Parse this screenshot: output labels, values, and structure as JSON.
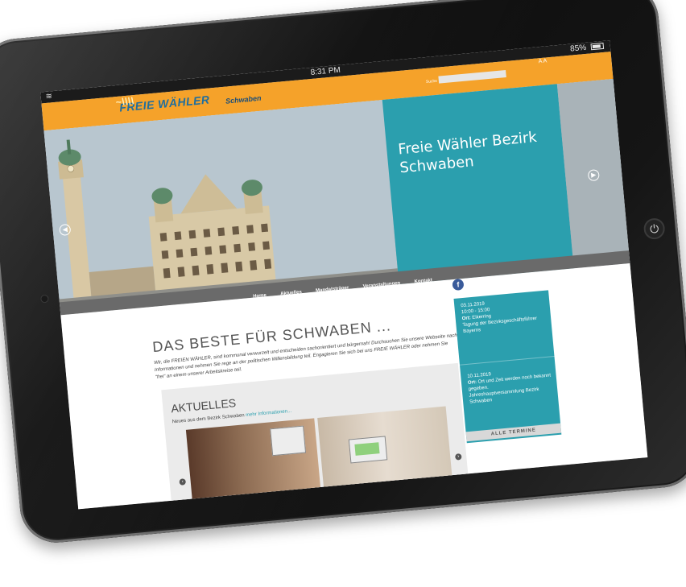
{
  "statusbar": {
    "time": "8:31 PM",
    "battery": "85%",
    "wifi_icon": "wifi-icon"
  },
  "header": {
    "logo_text": "FREIE WÄHLER",
    "region": "Schwaben",
    "font_size_control": "A A",
    "search_label": "Suche",
    "search_value": ""
  },
  "hero": {
    "title": "Freie Wähler Bezirk Schwaben"
  },
  "nav": {
    "items": [
      "Home",
      "Aktuelles",
      "Mandatsträger",
      "Veranstaltungen",
      "Kontakt"
    ]
  },
  "main": {
    "title": "DAS BESTE FÜR SCHWABEN ...",
    "intro": "Wir, die FREIEN WÄHLER, sind kommunal verwurzelt und entscheiden sachorientiert und bürgernah! Durchsuchen Sie unsere Webseite nach Informationen und nehmen Sie rege an der politischen Willensbildung teil. Engagieren Sie sich bei uns FREIE WÄHLER oder nehmen Sie \"frei\" an einem unserer Arbeitskreise teil.",
    "aktuelles": {
      "title": "AKTUELLES",
      "subtitle": "Neues aus dem Bezirk Schwaben",
      "more_link": "mehr Informationen..."
    }
  },
  "events": [
    {
      "date": "03.11.2019",
      "time": "10:00 - 15:00",
      "place_label": "Ort:",
      "place": "Eikerring",
      "title": "Tagung der Bezirksgeschäftsführer Bayerns"
    },
    {
      "date": "10.11.2019",
      "place_label": "Ort:",
      "place": "Ort und Zeit werden noch bekannt gegeben.",
      "title": "Jahreshauptversammlung Bezirk Schwaben"
    }
  ],
  "events_all_button": "ALLE TERMINE",
  "colors": {
    "accent_orange": "#f5a22a",
    "teal": "#2b9fae",
    "nav_gray": "#6a6a6a"
  }
}
